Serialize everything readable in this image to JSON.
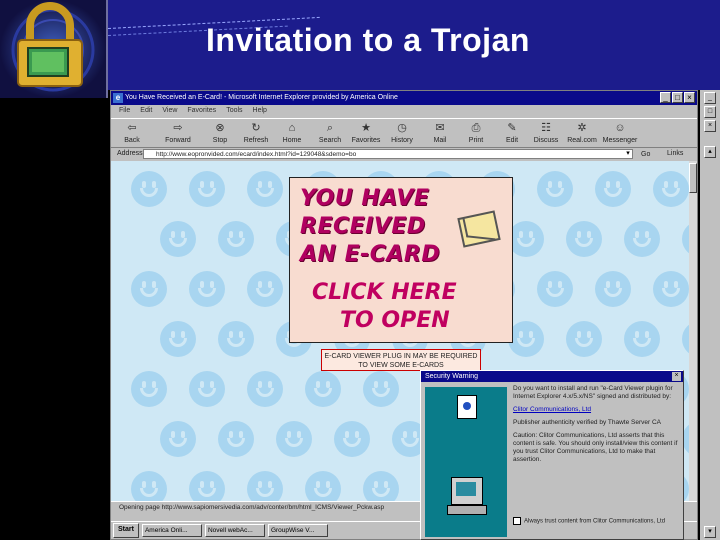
{
  "slide": {
    "title": "Invitation to a Trojan"
  },
  "browser": {
    "window_title": "You Have Received an E-Card! - Microsoft Internet Explorer provided by America Online",
    "menu": [
      "File",
      "Edit",
      "View",
      "Favorites",
      "Tools",
      "Help"
    ],
    "toolbar": [
      "Back",
      "Forward",
      "Stop",
      "Refresh",
      "Home",
      "Search",
      "Favorites",
      "History",
      "Mail",
      "Print",
      "Edit",
      "Discuss",
      "Real.com",
      "Messenger"
    ],
    "address_label": "Address",
    "address_url": "http://www.eopronvided.com/ecard/index.html?id=129048&sdemo=bo",
    "go_label": "Go",
    "links_label": "Links",
    "status_text": "Opening page http://www.sapiomersivedia.com/adv/conter/bm/html_ICMS/Viewer_Pckw.asp",
    "taskbar": {
      "start": "Start",
      "tasks": [
        "America Onli...",
        "Novell webAc...",
        "GroupWise V..."
      ]
    }
  },
  "ecard": {
    "line1": "YOU HAVE",
    "line2": "RECEIVED",
    "line3": "AN E-CARD",
    "click1": "CLICK HERE",
    "click2": "TO OPEN",
    "plugin_notice": "E-CARD VIEWER PLUG IN MAY BE REQUIRED TO VIEW SOME E-CARDS"
  },
  "security_warning": {
    "title": "Security Warning",
    "p1": "Do you want to install and run \"e-Card Viewer plugin for Internet Explorer 4.x/5.x/NS\" signed and distributed by:",
    "link": "Clitor Communications, Ltd",
    "p2": "Publisher authenticity verified by Thawte Server CA",
    "p3": "Caution: Clitor Communications, Ltd asserts that this content is safe. You should only install/view this content if you trust Clitor Communications, Ltd to make that assertion.",
    "checkbox": "Always trust content from Clitor Communications, Ltd"
  },
  "colors": {
    "slide_header": "#1c1c8c",
    "titlebar": "#0a0a8a",
    "page_bg": "#cfe8f5",
    "smiley": "#a8d5f0",
    "ecard_text": "#b00060"
  }
}
